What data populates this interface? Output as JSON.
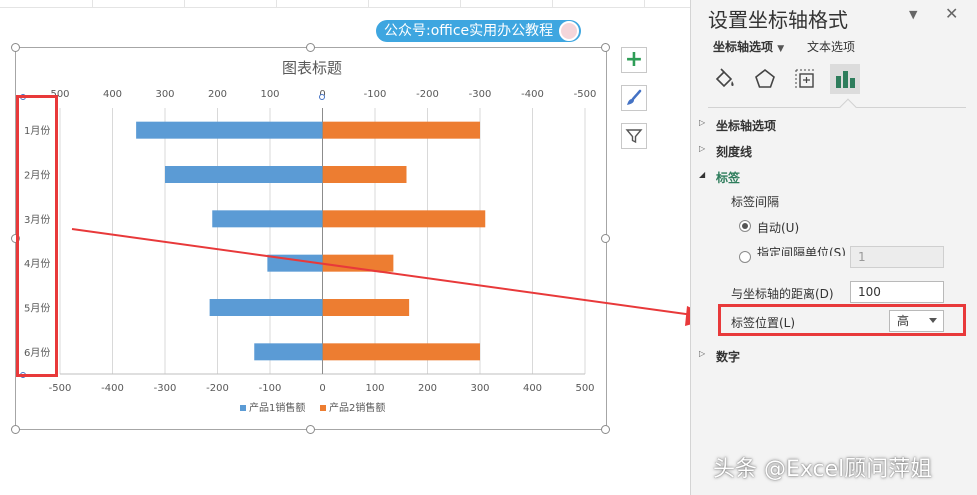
{
  "overlay": {
    "wechat_label": "公众号:office实用办公教程",
    "watermark": "头条 @Excel顾问萍姐"
  },
  "chart_data": {
    "type": "bar",
    "orientation": "horizontal",
    "title": "图表标题",
    "categories": [
      "1月份",
      "2月份",
      "3月份",
      "4月份",
      "5月份",
      "6月份"
    ],
    "series": [
      {
        "name": "产品1销售额",
        "values": [
          -355,
          -300,
          -210,
          -105,
          -215,
          -130
        ],
        "color": "#5b9bd5"
      },
      {
        "name": "产品2销售额",
        "values": [
          300,
          160,
          310,
          135,
          165,
          300
        ],
        "color": "#ed7d31"
      }
    ],
    "xlim": [
      -500,
      500
    ],
    "bottom_axis_ticks": [
      "-500",
      "-400",
      "-300",
      "-200",
      "-100",
      "0",
      "100",
      "200",
      "300",
      "400",
      "500"
    ],
    "top_axis_ticks": [
      "500",
      "400",
      "300",
      "200",
      "100",
      "0",
      "-100",
      "-200",
      "-300",
      "-400",
      "-500"
    ],
    "grid": true,
    "legend": "bottom"
  },
  "pane": {
    "title": "设置坐标轴格式",
    "tabs": [
      "坐标轴选项",
      "文本选项"
    ],
    "icons": [
      "fill-icon",
      "pentagon-icon",
      "size-properties-icon",
      "bar-chart-icon"
    ],
    "sections": {
      "axis_options": "坐标轴选项",
      "tick_marks": "刻度线",
      "labels": "标签",
      "number": "数字"
    },
    "label_interval": "标签间隔",
    "auto_label": "自动(U)",
    "specify_label": "指定间隔单位(S)",
    "specify_value": "1",
    "distance_label": "与坐标轴的距离(D)",
    "distance_value": "100",
    "position_label": "标签位置(L)",
    "position_value": "高"
  }
}
